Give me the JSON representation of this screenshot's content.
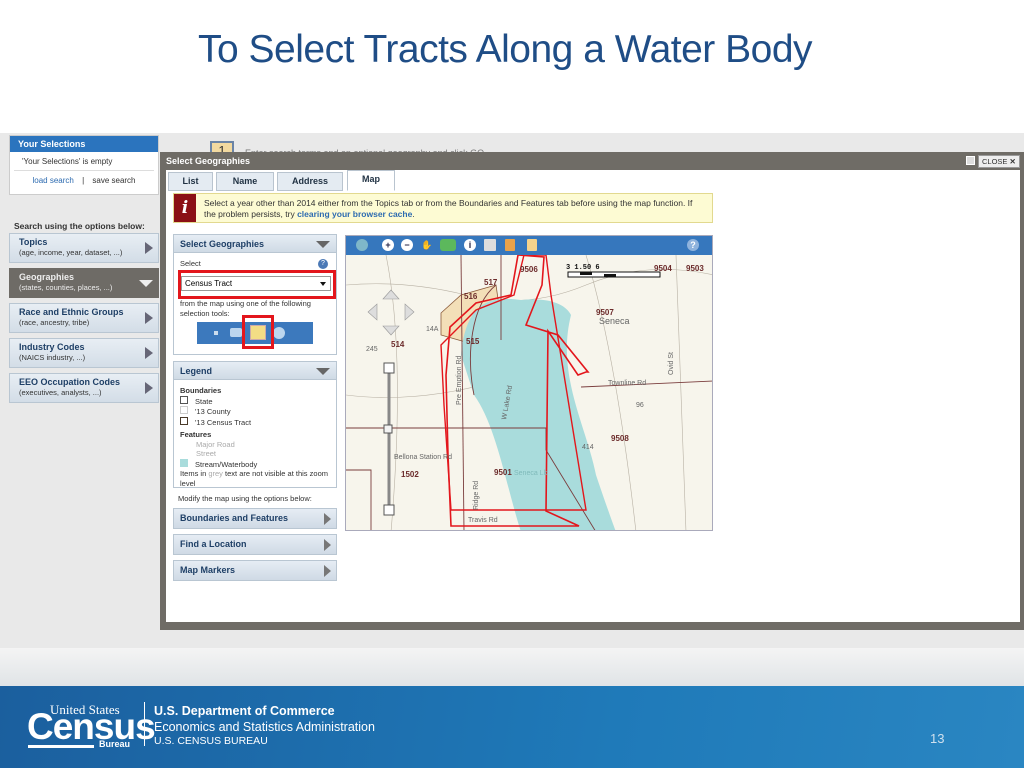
{
  "slide": {
    "title": "To Select Tracts Along a Water Body",
    "page_number": "13"
  },
  "left_panel": {
    "your_selections": {
      "header": "Your Selections",
      "empty_text": "'Your Selections' is empty",
      "load": "load search",
      "separator": "|",
      "save": "save search"
    },
    "search_label": "Search using the options below:",
    "items": [
      {
        "title": "Topics",
        "sub": "(age, income, year, dataset, ...)",
        "active": false
      },
      {
        "title": "Geographies",
        "sub": "(states, counties, places, ...)",
        "active": true
      },
      {
        "title": "Race and Ethnic Groups",
        "sub": "(race, ancestry, tribe)",
        "active": false
      },
      {
        "title": "Industry Codes",
        "sub": "(NAICS industry, ...)",
        "active": false
      },
      {
        "title": "EEO Occupation Codes",
        "sub": "(executives, analysts, ...)",
        "active": false
      }
    ]
  },
  "background_step": {
    "number": "1",
    "text": "Enter search terms and an optional geography and click GO"
  },
  "dialog": {
    "title": "Select Geographies",
    "close_label": "CLOSE",
    "tabs": [
      {
        "label": "List"
      },
      {
        "label": "Name"
      },
      {
        "label": "Address"
      },
      {
        "label": "Map",
        "selected": true
      }
    ],
    "info": {
      "text": "Select a year other than 2014 either from the Topics tab or from the Boundaries and Features tab before using the map function. If the problem persists, try ",
      "link": "clearing your browser cache",
      "end": "."
    },
    "select_geo": {
      "header": "Select Geographies",
      "select_label": "Select",
      "selected_value": "Census Tract",
      "hint": "from the map using one of the following selection tools:",
      "tools": [
        "point-tool",
        "rectangle-tool",
        "polygon-tool",
        "circle-tool"
      ],
      "active_tool": "polygon-tool"
    },
    "legend": {
      "header": "Legend",
      "boundaries_label": "Boundaries",
      "boundaries": [
        "State",
        "'13 County",
        "'13 Census Tract"
      ],
      "features_label": "Features",
      "features": [
        "Major Road",
        "Street",
        "Stream/Waterbody"
      ],
      "note_pre": "Items in ",
      "note_grey": "grey",
      "note_post": " text are not visible at this zoom level"
    },
    "modify_label": "Modify the map using the options below:",
    "options": [
      "Boundaries and Features",
      "Find a Location",
      "Map Markers"
    ],
    "map": {
      "toolbar": [
        "layers-icon",
        "zoom-in-icon",
        "zoom-out-icon",
        "pan-icon",
        "us-map-icon",
        "info-icon",
        "print-icon",
        "export-icon",
        "bookmark-icon",
        "help-icon"
      ],
      "scale": "3  1.50  6",
      "labels": {
        "tracts": [
          "9506",
          "517",
          "516",
          "514",
          "515",
          "9507",
          "9508",
          "9501",
          "1502",
          "9504",
          "9503"
        ],
        "place": "Seneca",
        "roads": [
          "Pre Emption Rd",
          "W Lake Rd",
          "Townline Rd",
          "Ovid St",
          "Bellona Station Rd",
          "Ridge Rd",
          "Travis Rd"
        ],
        "lake": "Seneca Lk",
        "highways": [
          "245",
          "14A",
          "96",
          "414"
        ]
      },
      "water_color": "#a9dcdc",
      "selection_color": "#e3161c"
    }
  },
  "footer": {
    "logo_top": "United States",
    "logo_main": "Census",
    "logo_bottom": "Bureau",
    "line1": "U.S. Department of Commerce",
    "line2": "Economics and Statistics Administration",
    "line3": "U.S. CENSUS BUREAU"
  }
}
